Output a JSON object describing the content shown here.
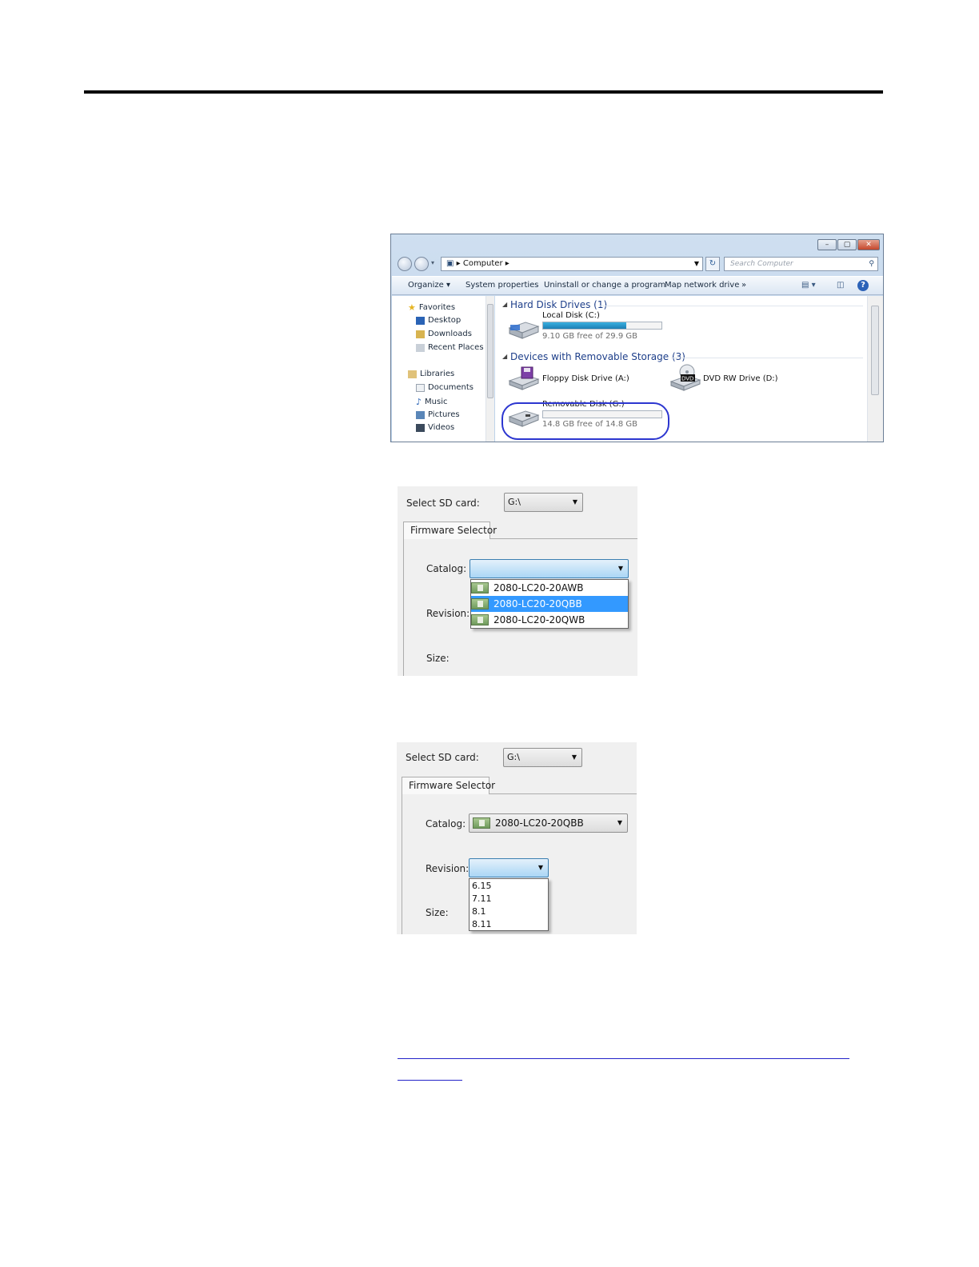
{
  "explorer": {
    "address": [
      "Computer"
    ],
    "search_placeholder": "Search Computer",
    "commands": [
      "Organize ▾",
      "System properties",
      "Uninstall or change a program",
      "Map network drive",
      "»"
    ],
    "nav": {
      "favorites": "Favorites",
      "favorites_items": [
        "Desktop",
        "Downloads",
        "Recent Places"
      ],
      "libraries": "Libraries",
      "libraries_items": [
        "Documents",
        "Music",
        "Pictures",
        "Videos"
      ]
    },
    "groups": {
      "hdd": "Hard Disk Drives (1)",
      "removable": "Devices with Removable Storage (3)"
    },
    "drives": {
      "local": {
        "name": "Local Disk (C:)",
        "free": "9.10 GB free of 29.9 GB",
        "used_fraction": 0.7
      },
      "floppy": {
        "name": "Floppy Disk Drive (A:)"
      },
      "dvd": {
        "name": "DVD RW Drive (D:)",
        "badge": "DVD"
      },
      "removable": {
        "name": "Removable Disk (G:)",
        "free": "14.8 GB free of 14.8 GB",
        "used_fraction": 0.0
      }
    },
    "highlight_color": "#2c36d0"
  },
  "panel1": {
    "sd_label": "Select SD card:",
    "sd_value": "G:\\",
    "tab": "Firmware Selector",
    "catalog_label": "Catalog:",
    "revision_label": "Revision:",
    "size_label": "Size:",
    "catalog_options": [
      "2080-LC20-20AWB",
      "2080-LC20-20QBB",
      "2080-LC20-20QWB"
    ],
    "selected_index": 1
  },
  "panel2": {
    "sd_label": "Select SD card:",
    "sd_value": "G:\\",
    "tab": "Firmware Selector",
    "catalog_label": "Catalog:",
    "catalog_value": "2080-LC20-20QBB",
    "revision_label": "Revision:",
    "size_label": "Size:",
    "revision_options": [
      "6.15",
      "7.11",
      "8.1",
      "8.11"
    ]
  }
}
